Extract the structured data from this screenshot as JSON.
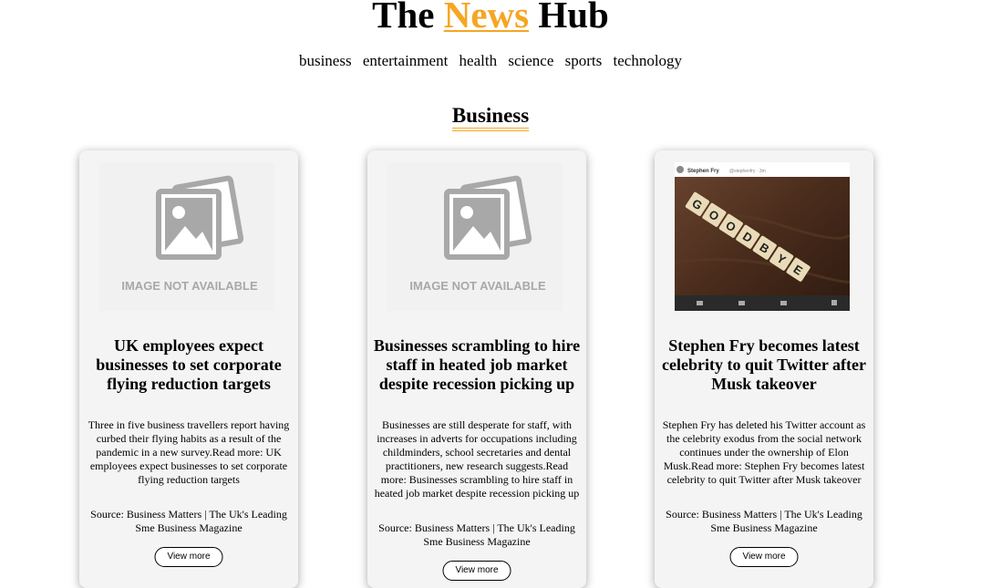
{
  "header": {
    "title_prefix": "The",
    "title_accent": "News",
    "title_suffix": "Hub"
  },
  "nav": {
    "items": [
      "business",
      "entertainment",
      "health",
      "science",
      "sports",
      "technology"
    ]
  },
  "section": {
    "heading": "Business"
  },
  "colors": {
    "accent": "#f5a623",
    "card_background": "#f4f4f4"
  },
  "placeholder_image_text": "IMAGE NOT AVAILABLE",
  "cards": [
    {
      "title": "UK employees expect businesses to set corporate flying reduction targets",
      "description": "Three in five business travellers report having curbed their flying habits as a result of the pandemic in a new survey.Read more: UK employees expect businesses to set corporate flying reduction targets",
      "source": "Source: Business Matters | The Uk's Leading Sme Business Magazine",
      "button_label": "View more",
      "image": "placeholder"
    },
    {
      "title": "Businesses scrambling to hire staff in heated job market despite recession picking up",
      "description": "Businesses are still desperate for staff, with increases in adverts for occupations including childminders, school secretaries and dental practitioners, new research suggests.Read more: Businesses scrambling to hire staff in heated job market despite recession picking up",
      "source": "Source: Business Matters | The Uk's Leading Sme Business Magazine",
      "button_label": "View more",
      "image": "placeholder"
    },
    {
      "title": "Stephen Fry becomes latest celebrity to quit Twitter after Musk takeover",
      "description": "Stephen Fry has deleted his Twitter account as the celebrity exodus from the social network continues under the ownership of Elon Musk.Read more: Stephen Fry becomes latest celebrity to quit Twitter after Musk takeover",
      "source": "Source: Business Matters | The Uk's Leading Sme Business Magazine",
      "button_label": "View more",
      "image": "photo",
      "image_header_text": "Stephen Fry",
      "image_tile_letters": "GOODBYE"
    }
  ]
}
